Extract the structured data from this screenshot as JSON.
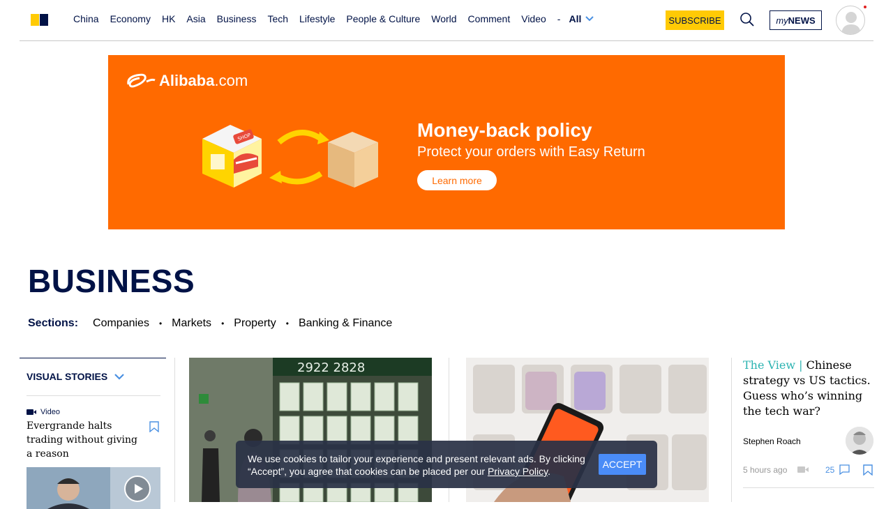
{
  "header": {
    "nav_items": [
      "China",
      "Economy",
      "HK",
      "Asia",
      "Business",
      "Tech",
      "Lifestyle",
      "People & Culture",
      "World",
      "Comment",
      "Video"
    ],
    "nav_dash": "-",
    "nav_all": "All",
    "subscribe_label": "SUBSCRIBE",
    "mynews_prefix": "my",
    "mynews_suffix": "NEWS"
  },
  "ad": {
    "brand": "Alibaba",
    "brand_suffix": ".com",
    "headline": "Money-back policy",
    "subline": "Protect your orders with Easy Return",
    "cta": "Learn more",
    "shop_sign": "SHOP",
    "accent_color": "#ff6a00"
  },
  "page": {
    "title": "BUSINESS",
    "sections_label": "Sections:",
    "sections": [
      "Companies",
      "Markets",
      "Property",
      "Banking & Finance"
    ]
  },
  "visual_stories": {
    "heading": "VISUAL STORIES",
    "tag": "Video",
    "title": "Evergrande halts trading without giving a reason"
  },
  "images": {
    "property_numbers": "2922 2828"
  },
  "opinion": {
    "kicker": "The View |",
    "title": " Chinese strategy vs US tactics. Guess who’s winning the tech war?",
    "author": "Stephen Roach",
    "time": "5 hours ago",
    "comments": "25"
  },
  "cookie": {
    "text": "We use cookies to tailor your experience and present relevant ads. By clicking “Accept”, you agree that cookies can be placed per our ",
    "link": "Privacy Policy",
    "end": ".",
    "accept": "ACCEPT"
  }
}
